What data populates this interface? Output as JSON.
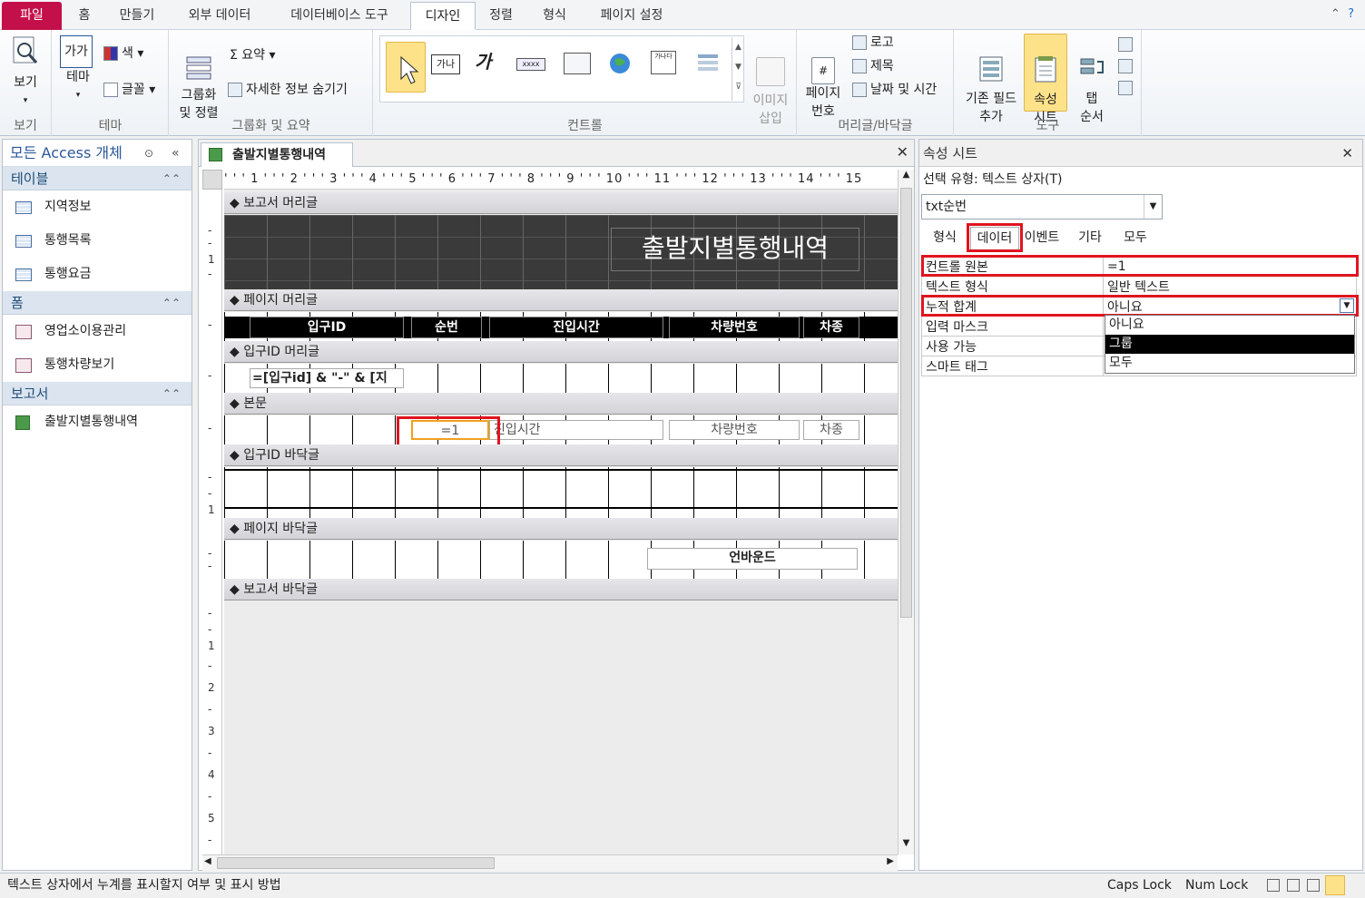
{
  "ribbon_tabs": [
    "파일",
    "홈",
    "만들기",
    "외부 데이터",
    "데이터베이스 도구",
    "디자인",
    "정렬",
    "형식",
    "페이지 설정"
  ],
  "ribbon": {
    "view": {
      "label": "보기",
      "group": "보기"
    },
    "theme": {
      "label": "테마",
      "color": "색",
      "font": "글꼴",
      "group": "테마"
    },
    "grouping": {
      "group_sort": "그룹화\n및 정렬",
      "totals": "Σ 요약",
      "hide_details": "자세한 정보 숨기기",
      "group": "그룹화 및 요약"
    },
    "controls": {
      "group": "컨트롤",
      "image_insert": "이미지\n삽입"
    },
    "header_footer": {
      "page_number": "페이지\n번호",
      "logo": "로고",
      "title": "제목",
      "date_time": "날짜 및 시간",
      "group": "머리글/바닥글"
    },
    "tools": {
      "add_fields": "기존 필드\n추가",
      "property_sheet": "속성\n시트",
      "tab_order": "탭\n순서",
      "group": "도구"
    }
  },
  "nav": {
    "title": "모든 Access 개체",
    "sections": [
      {
        "name": "테이블",
        "items": [
          "지역정보",
          "통행목록",
          "통행요금"
        ]
      },
      {
        "name": "폼",
        "items": [
          "영업소이용관리",
          "통행차량보기"
        ]
      },
      {
        "name": "보고서",
        "items": [
          "출발지별통행내역"
        ]
      }
    ]
  },
  "doc": {
    "tab_title": "출발지별통행내역",
    "ruler": "' ' ' 1 ' ' ' 2 ' ' ' 3 ' ' ' 4 ' ' ' 5 ' ' ' 6 ' ' ' 7 ' ' ' 8 ' ' ' 9 ' ' ' 10 ' ' ' 11 ' ' ' 12 ' ' ' 13 ' ' ' 14 ' ' ' 15",
    "sections": {
      "report_header": "보고서 머리글",
      "page_header": "페이지 머리글",
      "group_header": "입구ID 머리글",
      "detail": "본문",
      "group_footer": "입구ID 바닥글",
      "page_footer": "페이지 바닥글",
      "report_footer": "보고서 바닥글"
    },
    "report_title": "출발지별통행내역",
    "columns": [
      "입구ID",
      "순번",
      "진입시간",
      "차량번호",
      "차종"
    ],
    "group_expr": "=[입구id] & \"-\" & [지",
    "detail": {
      "seq": "=1",
      "entry_time": "진입시간",
      "car_no": "차량번호",
      "car_type": "차종"
    },
    "page_footer_text": "언바운드"
  },
  "property_sheet": {
    "title": "속성 시트",
    "selection_type": "선택 유형: 텍스트 상자(T)",
    "selected_control": "txt순번",
    "tabs": [
      "형식",
      "데이터",
      "이벤트",
      "기타",
      "모두"
    ],
    "rows": [
      {
        "name": "컨트롤 원본",
        "value": "=1"
      },
      {
        "name": "텍스트 형식",
        "value": "일반 텍스트"
      },
      {
        "name": "누적 합계",
        "value": "아니요"
      },
      {
        "name": "입력 마스크",
        "value": ""
      },
      {
        "name": "사용 가능",
        "value": ""
      },
      {
        "name": "스마트 태그",
        "value": ""
      }
    ],
    "dropdown": [
      "아니요",
      "그룹",
      "모두"
    ]
  },
  "status": {
    "message": "텍스트 상자에서 누계를 표시할지 여부 및 표시 방법",
    "caps": "Caps Lock",
    "num": "Num Lock"
  }
}
